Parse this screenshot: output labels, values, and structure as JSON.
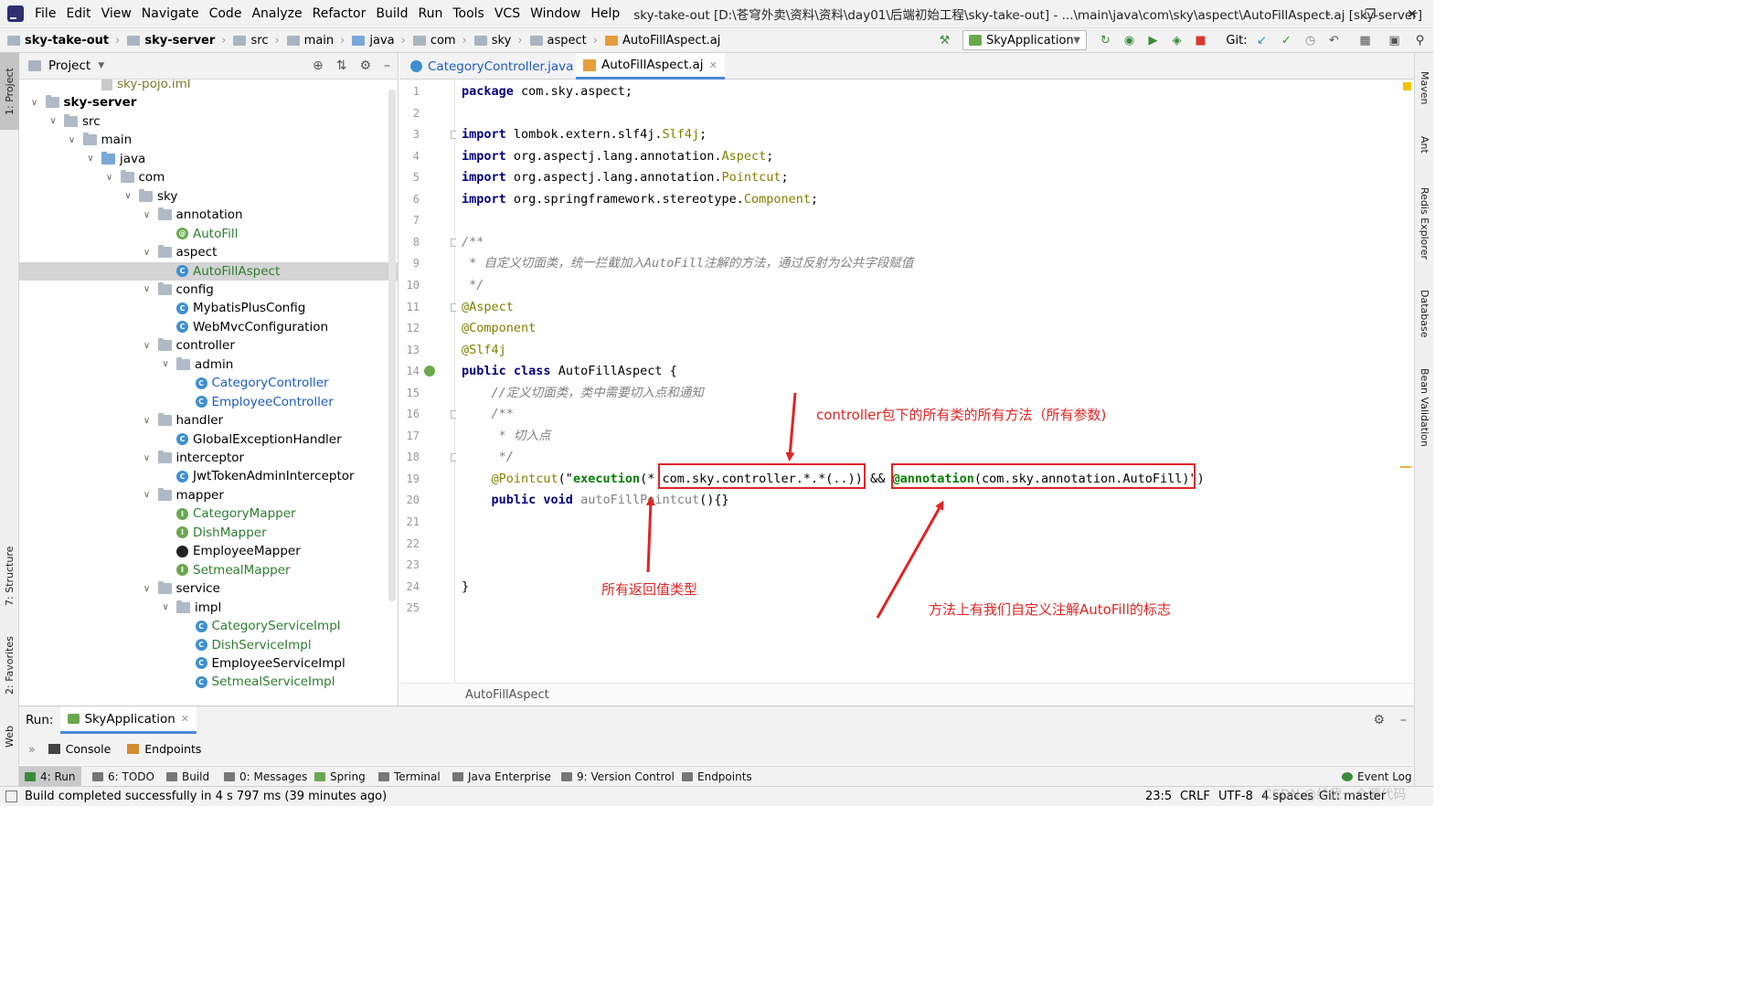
{
  "menubar": {
    "items": [
      "File",
      "Edit",
      "View",
      "Navigate",
      "Code",
      "Analyze",
      "Refactor",
      "Build",
      "Run",
      "Tools",
      "VCS",
      "Window",
      "Help"
    ],
    "title": "sky-take-out [D:\\苍穹外卖\\资料\\资料\\day01\\后端初始工程\\sky-take-out] - ...\\main\\java\\com\\sky\\aspect\\AutoFillAspect.aj [sky-server]"
  },
  "navbar": {
    "crumbs": [
      "sky-take-out",
      "sky-server",
      "src",
      "main",
      "java",
      "com",
      "sky",
      "aspect",
      "AutoFillAspect.aj"
    ],
    "run_config": "SkyApplication",
    "git_label": "Git:"
  },
  "left_strip": {
    "project": "1: Project",
    "structure": "7: Structure",
    "favorites": "2: Favorites",
    "web": "Web"
  },
  "right_strip": {
    "maven": "Maven",
    "ant": "Ant",
    "redis": "Redis Explorer",
    "database": "Database",
    "bean": "Bean Validation"
  },
  "project": {
    "header": "Project",
    "tree": [
      {
        "label": "sky-pojo.iml",
        "indent": 4,
        "kind": "file",
        "color": "olive"
      },
      {
        "label": "sky-server",
        "indent": 1,
        "kind": "module",
        "arrow": "v",
        "bold": true
      },
      {
        "label": "src",
        "indent": 2,
        "kind": "folder",
        "arrow": "v"
      },
      {
        "label": "main",
        "indent": 3,
        "kind": "folder",
        "arrow": "v"
      },
      {
        "label": "java",
        "indent": 4,
        "kind": "folder-blue",
        "arrow": "v"
      },
      {
        "label": "com",
        "indent": 5,
        "kind": "folder",
        "arrow": "v"
      },
      {
        "label": "sky",
        "indent": 6,
        "kind": "folder",
        "arrow": "v"
      },
      {
        "label": "annotation",
        "indent": 7,
        "kind": "folder",
        "arrow": "v"
      },
      {
        "label": "AutoFill",
        "indent": 8,
        "kind": "annotation",
        "color": "green"
      },
      {
        "label": "aspect",
        "indent": 7,
        "kind": "folder",
        "arrow": "v"
      },
      {
        "label": "AutoFillAspect",
        "indent": 8,
        "kind": "class",
        "color": "green",
        "selected": true
      },
      {
        "label": "config",
        "indent": 7,
        "kind": "folder",
        "arrow": "v"
      },
      {
        "label": "MybatisPlusConfig",
        "indent": 8,
        "kind": "class"
      },
      {
        "label": "WebMvcConfiguration",
        "indent": 8,
        "kind": "class"
      },
      {
        "label": "controller",
        "indent": 7,
        "kind": "folder",
        "arrow": "v"
      },
      {
        "label": "admin",
        "indent": 8,
        "kind": "folder",
        "arrow": "v"
      },
      {
        "label": "CategoryController",
        "indent": 9,
        "kind": "class",
        "color": "blue"
      },
      {
        "label": "EmployeeController",
        "indent": 9,
        "kind": "class",
        "color": "blue"
      },
      {
        "label": "handler",
        "indent": 7,
        "kind": "folder",
        "arrow": "v"
      },
      {
        "label": "GlobalExceptionHandler",
        "indent": 8,
        "kind": "class"
      },
      {
        "label": "interceptor",
        "indent": 7,
        "kind": "folder",
        "arrow": "v"
      },
      {
        "label": "JwtTokenAdminInterceptor",
        "indent": 8,
        "kind": "class"
      },
      {
        "label": "mapper",
        "indent": 7,
        "kind": "folder",
        "arrow": "v"
      },
      {
        "label": "CategoryMapper",
        "indent": 8,
        "kind": "interface",
        "color": "green"
      },
      {
        "label": "DishMapper",
        "indent": 8,
        "kind": "interface",
        "color": "green"
      },
      {
        "label": "EmployeeMapper",
        "indent": 8,
        "kind": "bird"
      },
      {
        "label": "SetmealMapper",
        "indent": 8,
        "kind": "interface",
        "color": "green"
      },
      {
        "label": "service",
        "indent": 7,
        "kind": "folder",
        "arrow": "v"
      },
      {
        "label": "impl",
        "indent": 8,
        "kind": "folder",
        "arrow": "v"
      },
      {
        "label": "CategoryServiceImpl",
        "indent": 9,
        "kind": "class",
        "color": "green"
      },
      {
        "label": "DishServiceImpl",
        "indent": 9,
        "kind": "class",
        "color": "green"
      },
      {
        "label": "EmployeeServiceImpl",
        "indent": 9,
        "kind": "class"
      },
      {
        "label": "SetmealServiceImpl",
        "indent": 9,
        "kind": "class",
        "color": "green"
      }
    ]
  },
  "editor": {
    "tabs": [
      {
        "label": "CategoryController.java",
        "active": false
      },
      {
        "label": "AutoFillAspect.aj",
        "active": true
      }
    ],
    "breadcrumb": "AutoFillAspect",
    "line_numbers": [
      "1",
      "2",
      "3",
      "4",
      "5",
      "6",
      "7",
      "8",
      "9",
      "10",
      "11",
      "12",
      "13",
      "14",
      "15",
      "16",
      "17",
      "18",
      "19",
      "20",
      "21",
      "22",
      "23",
      "24",
      "25"
    ],
    "lines": [
      [
        [
          "kw",
          "package"
        ],
        [
          "",
          "com.sky.aspect;"
        ]
      ],
      [],
      [
        [
          "kw",
          "import"
        ],
        [
          "",
          "lombok.extern.slf4j."
        ],
        [
          "ann",
          "Slf4j"
        ],
        [
          "",
          ";"
        ]
      ],
      [
        [
          "kw",
          "import"
        ],
        [
          "",
          "org.aspectj.lang.annotation."
        ],
        [
          "ann",
          "Aspect"
        ],
        [
          "",
          ";"
        ]
      ],
      [
        [
          "kw",
          "import"
        ],
        [
          "",
          "org.aspectj.lang.annotation."
        ],
        [
          "ann",
          "Pointcut"
        ],
        [
          "",
          ";"
        ]
      ],
      [
        [
          "kw",
          "import"
        ],
        [
          "",
          "org.springframework.stereotype."
        ],
        [
          "ann",
          "Component"
        ],
        [
          "",
          ";"
        ]
      ],
      [],
      [
        [
          "cmt",
          "/**"
        ]
      ],
      [
        [
          "cmt",
          " * 自定义切面类，统一拦截加入AutoFill注解的方法，通过反射为公共字段赋值"
        ]
      ],
      [
        [
          "cmt",
          " */"
        ]
      ],
      [
        [
          "ann",
          "@Aspect"
        ]
      ],
      [
        [
          "ann",
          "@Component"
        ]
      ],
      [
        [
          "ann",
          "@Slf4j"
        ]
      ],
      [
        [
          "kw",
          "public class"
        ],
        [
          "",
          "AutoFillAspect {"
        ]
      ],
      [
        [
          "cmt",
          "    //定义切面类，类中需要切入点和通知"
        ]
      ],
      [
        [
          "cmt",
          "    /**"
        ]
      ],
      [
        [
          "cmt",
          "     * 切入点"
        ]
      ],
      [
        [
          "cmt",
          "     */"
        ]
      ],
      [
        [
          "ann",
          "    @Pointcut"
        ],
        [
          "",
          "(\""
        ],
        [
          "str",
          "execution"
        ],
        [
          "",
          "(* com.sky.controller.*.*(..)) && "
        ],
        [
          "str",
          "@annotation"
        ],
        [
          "",
          "(com.sky.annotation.AutoFill)\")"
        ]
      ],
      [
        [
          "kw",
          "    public void"
        ],
        [
          "gray",
          "autoFillPointcut"
        ],
        [
          "",
          "(){}"
        ]
      ],
      [],
      [],
      [],
      [
        [
          "",
          "}"
        ]
      ],
      []
    ]
  },
  "annotations": {
    "top": "controller包下的所有类的所有方法（所有参数)",
    "bottom_left": "所有返回值类型",
    "bottom_right": "方法上有我们自定义注解AutoFill的标志"
  },
  "run_panel": {
    "run_label": "Run:",
    "app_tab": "SkyApplication",
    "console": "Console",
    "endpoints": "Endpoints"
  },
  "toolwindows": [
    "4: Run",
    "6: TODO",
    "Build",
    "0: Messages",
    "Spring",
    "Terminal",
    "Java Enterprise",
    "9: Version Control",
    "Endpoints"
  ],
  "event_log": "Event Log",
  "status": {
    "message": "Build completed successfully in 4 s 797 ms (39 minutes ago)",
    "position": "23:5",
    "line_sep": "CRLF",
    "encoding": "UTF-8",
    "indent": "4 spaces",
    "git": "Git: master",
    "watermark": "CSDN @给我一个源代码"
  },
  "colors": {
    "keyword": "#000080",
    "annotation": "#808000",
    "comment": "#808080",
    "string": "#008000",
    "markup_red": "#e02424"
  }
}
